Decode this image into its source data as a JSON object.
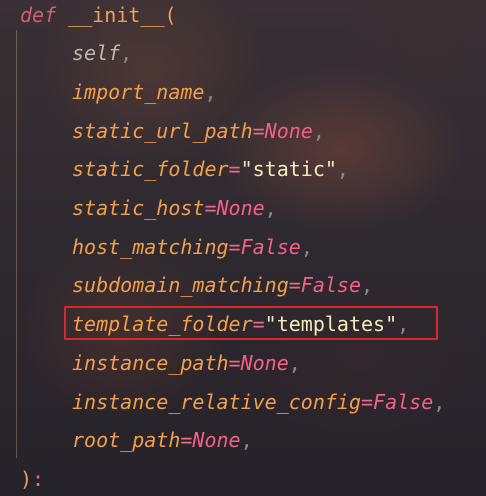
{
  "code": {
    "signature": {
      "keyword": "def",
      "function_name": "__init__",
      "open_paren": "("
    },
    "params": [
      {
        "name": "self",
        "op": "",
        "value": "",
        "value_kind": "none",
        "comma": ","
      },
      {
        "name": "import_name",
        "op": "",
        "value": "",
        "value_kind": "none",
        "comma": ","
      },
      {
        "name": "static_url_path",
        "op": "=",
        "value": "None",
        "value_kind": "const",
        "comma": ","
      },
      {
        "name": "static_folder",
        "op": "=",
        "value": "\"static\"",
        "value_kind": "string",
        "comma": ","
      },
      {
        "name": "static_host",
        "op": "=",
        "value": "None",
        "value_kind": "const",
        "comma": ","
      },
      {
        "name": "host_matching",
        "op": "=",
        "value": "False",
        "value_kind": "const",
        "comma": ","
      },
      {
        "name": "subdomain_matching",
        "op": "=",
        "value": "False",
        "value_kind": "const",
        "comma": ","
      },
      {
        "name": "template_folder",
        "op": "=",
        "value": "\"templates\"",
        "value_kind": "string",
        "comma": ","
      },
      {
        "name": "instance_path",
        "op": "=",
        "value": "None",
        "value_kind": "const",
        "comma": ","
      },
      {
        "name": "instance_relative_config",
        "op": "=",
        "value": "False",
        "value_kind": "const",
        "comma": ","
      },
      {
        "name": "root_path",
        "op": "=",
        "value": "None",
        "value_kind": "const",
        "comma": ","
      }
    ],
    "closing": {
      "paren": ")",
      "colon": ":"
    },
    "highlighted_param": "template_folder"
  },
  "colors": {
    "highlight_border": "#d42a2a",
    "keyword": "#d45c79",
    "param_name": "#f29f4d",
    "constant": "#f46088",
    "string": "#f5e9b7"
  }
}
